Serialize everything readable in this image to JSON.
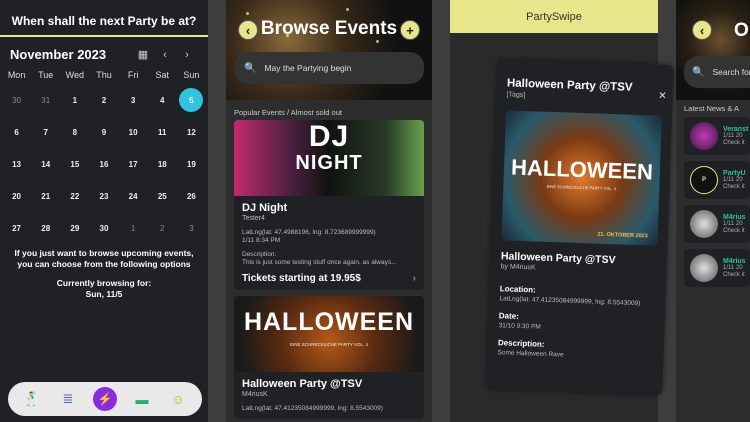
{
  "calendar": {
    "question": "When shall the next Party be at?",
    "month": "November 2023",
    "weekdays": [
      "Mon",
      "Tue",
      "Wed",
      "Thu",
      "Fri",
      "Sat",
      "Sun"
    ],
    "weeks": [
      [
        "30",
        "31",
        "1",
        "2",
        "3",
        "4",
        "5"
      ],
      [
        "6",
        "7",
        "8",
        "9",
        "10",
        "11",
        "12"
      ],
      [
        "13",
        "14",
        "15",
        "16",
        "17",
        "18",
        "19"
      ],
      [
        "20",
        "21",
        "22",
        "23",
        "24",
        "25",
        "26"
      ],
      [
        "27",
        "28",
        "29",
        "30",
        "1",
        "2",
        "3"
      ]
    ],
    "selected": "5",
    "info": "If you just want to browse upcoming events, you can choose from the following options",
    "browsing_label": "Currently browsing for:",
    "browsing_value": "Sun, 11/5",
    "accent": "#2ec4e0"
  },
  "browse": {
    "title": "Browse Events",
    "search_placeholder": "May the Partying begin",
    "section": "Popular Events / Almost sold out",
    "events": [
      {
        "image_text_1": "DJ",
        "image_text_2": "NIGHT",
        "name": "DJ Night",
        "host": "Tester4",
        "location": "LatLng(lat: 47.4988196, lng: 8.723689999999)",
        "time": "1/11 8:34 PM",
        "desc_label": "Description:",
        "desc": "This is just some testing stuff once again, as always...",
        "tickets": "Tickets starting at 19.95$"
      },
      {
        "image_text_1": "HALLOWEEN",
        "image_sub": "EINE SCHRECKLICHE PARTY VOL. 4",
        "name": "Halloween Party @TSV",
        "host": "M4riusK",
        "location": "LatLng(lat: 47.41235084999999, lng: 8.5543009)"
      }
    ]
  },
  "swipe": {
    "app_title": "PartySwipe",
    "card_title": "Halloween Party @TSV",
    "tags": "[Tags]",
    "image_text": "HALLOWEEN",
    "image_sub": "EINE SCHRECKLICHE PARTY VOL. 4",
    "image_date": "21. OKTOBER 2023",
    "name": "Halloween Party @TSV",
    "by": "by M4riusK",
    "location_label": "Location:",
    "location": "LatLng(lat: 47.41235084999999, lng: 8.5543009)",
    "date_label": "Date:",
    "date": "31/10 9:30 PM",
    "desc_label": "Description:",
    "desc": "Some Halloween Rave"
  },
  "news": {
    "title": "O",
    "search_placeholder": "Search for",
    "section": "Latest News & A",
    "items": [
      {
        "name": "Veranst",
        "date": "1/11 20",
        "text": "Check it"
      },
      {
        "name": "PartyU",
        "date": "1/11 20",
        "text": "Check it"
      },
      {
        "name": "M4rius",
        "date": "1/11 20",
        "text": "Check it"
      },
      {
        "name": "M4rius",
        "date": "1/11 20",
        "text": "Check it"
      }
    ]
  }
}
